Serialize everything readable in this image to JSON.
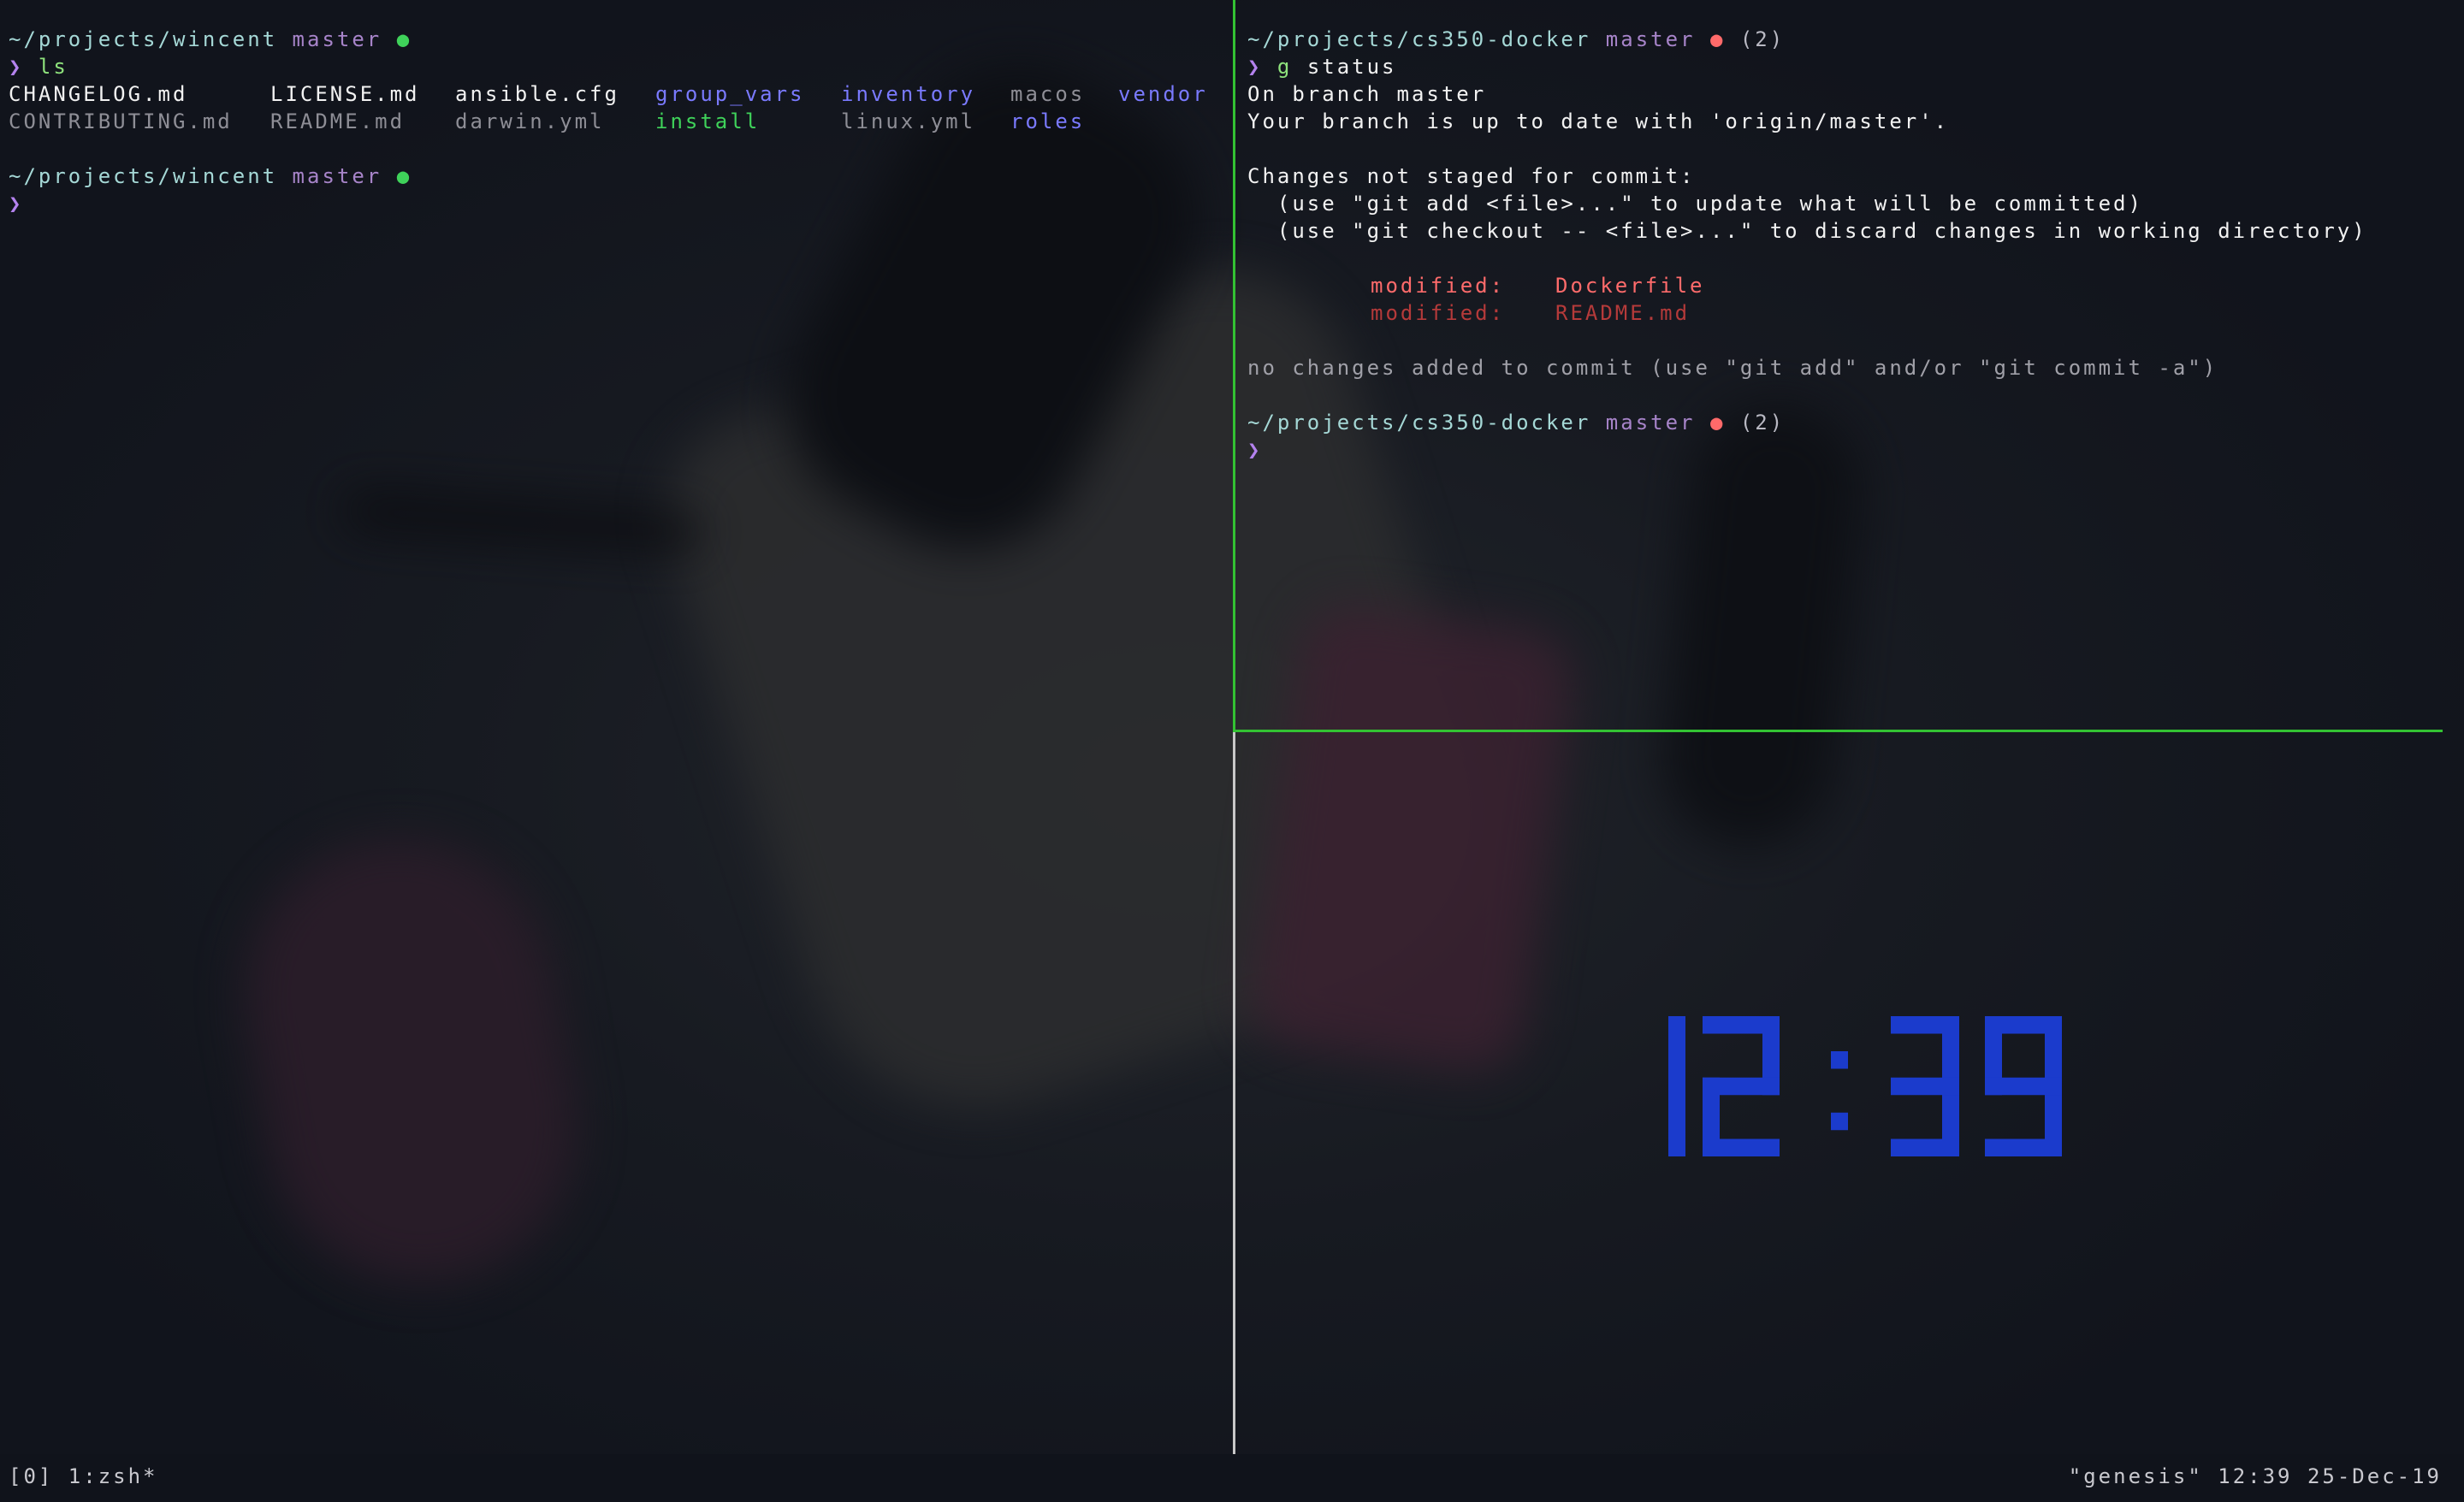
{
  "colors": {
    "background": "#11141c",
    "path": "#a5d8d6",
    "branch": "#a784c9",
    "clean_dot": "#3fd25a",
    "dirty_dot": "#ff6a6a",
    "prompt": "#b482ee",
    "directory": "#7a7aff",
    "executable": "#3fd25a",
    "modified": "#ff6b6b",
    "modified_dim": "#b53a3a",
    "clock": "#1b3bcc",
    "active_border": "#33c233"
  },
  "left_pane": {
    "prompt1": {
      "path": "~/projects/wincent",
      "branch": "master",
      "dot": "●"
    },
    "command1": {
      "caret": "❯",
      "text": "ls"
    },
    "ls_row1": [
      "CHANGELOG.md",
      "LICENSE.md",
      "ansible.cfg",
      "group_vars",
      "inventory",
      "macos",
      "vendor"
    ],
    "ls_row2": [
      "CONTRIBUTING.md",
      "README.md",
      "darwin.yml",
      "install",
      "linux.yml",
      "roles"
    ],
    "prompt2": {
      "path": "~/projects/wincent",
      "branch": "master",
      "dot": "●"
    },
    "command2": {
      "caret": "❯",
      "text": ""
    }
  },
  "right_top_pane": {
    "prompt1": {
      "path": "~/projects/cs350-docker",
      "branch": "master",
      "dot": "●",
      "count": "(2)"
    },
    "command1": {
      "caret": "❯",
      "cmd": "g",
      "args": "status"
    },
    "output": {
      "line1": "On branch master",
      "line2": "Your branch is up to date with 'origin/master'.",
      "line3": "Changes not staged for commit:",
      "line4": "  (use \"git add <file>...\" to update what will be committed)",
      "line5": "  (use \"git checkout -- <file>...\" to discard changes in working directory)",
      "modified1_label": "modified:",
      "modified1_file": "Dockerfile",
      "modified2_label": "modified:",
      "modified2_file": "README.md",
      "summary": "no changes added to commit (use \"git add\" and/or \"git commit -a\")"
    },
    "prompt2": {
      "path": "~/projects/cs350-docker",
      "branch": "master",
      "dot": "●",
      "count": "(2)"
    },
    "command2": {
      "caret": "❯",
      "text": ""
    }
  },
  "clock": {
    "time": "12:39"
  },
  "statusbar": {
    "left": "[0] 1:zsh*",
    "right": "\"genesis\" 12:39 25-Dec-19"
  }
}
